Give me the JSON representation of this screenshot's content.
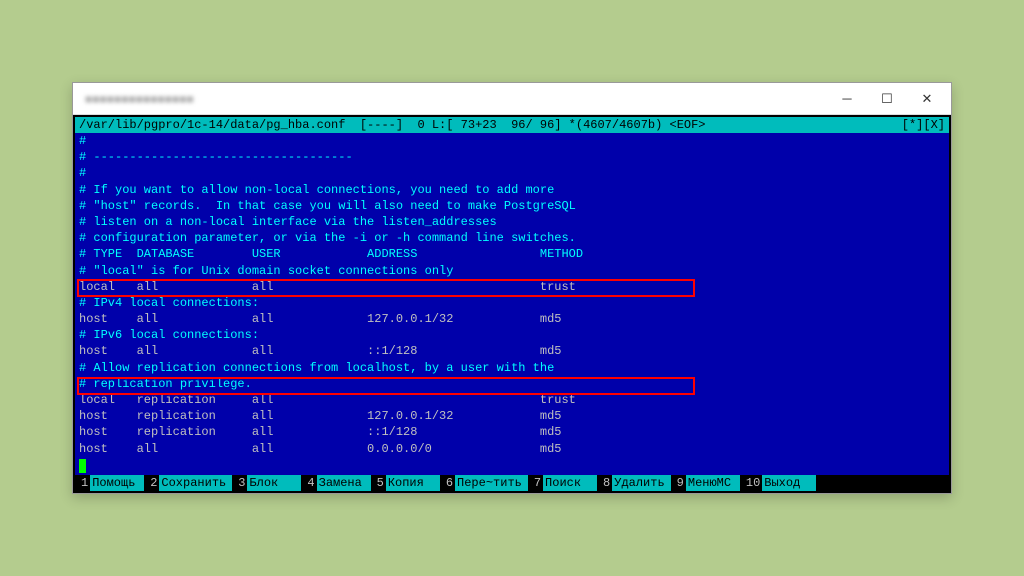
{
  "titlebar": {
    "blur_text": "■■■■■■■■■■■■■■■"
  },
  "winbtns": {
    "min": "─",
    "max": "☐",
    "close": "✕"
  },
  "status": {
    "left": "/var/lib/pgpro/1c-14/data/pg_hba.conf  [----]  0 L:[ 73+23  96/ 96] *(4607/4607b) <EOF>",
    "right": "[*][X]"
  },
  "lines": [
    "#",
    "# ------------------------------------",
    "#",
    "# If you want to allow non-local connections, you need to add more ",
    "# \"host\" records.  In that case you will also need to make PostgreSQL",
    "# listen on a non-local interface via the listen_addresses",
    "# configuration parameter, or via the -i or -h command line switches.",
    "",
    "",
    "",
    "# TYPE  DATABASE        USER            ADDRESS                 METHOD",
    "",
    "# \"local\" is for Unix domain socket connections only",
    "local   all             all                                     trust",
    "# IPv4 local connections:",
    "host    all             all             127.0.0.1/32            md5",
    "# IPv6 local connections:",
    "host    all             all             ::1/128                 md5",
    "# Allow replication connections from localhost, by a user with the",
    "# replication privilege.",
    "local   replication     all                                     trust",
    "host    replication     all             127.0.0.1/32            md5",
    "host    replication     all             ::1/128                 md5",
    "host    all             all             0.0.0.0/0               md5"
  ],
  "fkeys": [
    {
      "n": "1",
      "label": "Помощь"
    },
    {
      "n": "2",
      "label": "Сохранить"
    },
    {
      "n": "3",
      "label": "Блок"
    },
    {
      "n": "4",
      "label": "Замена"
    },
    {
      "n": "5",
      "label": "Копия"
    },
    {
      "n": "6",
      "label": "Пере~тить"
    },
    {
      "n": "7",
      "label": "Поиск"
    },
    {
      "n": "8",
      "label": "Удалить"
    },
    {
      "n": "9",
      "label": "МенюMC"
    },
    {
      "n": "10",
      "label": "Выход"
    }
  ]
}
